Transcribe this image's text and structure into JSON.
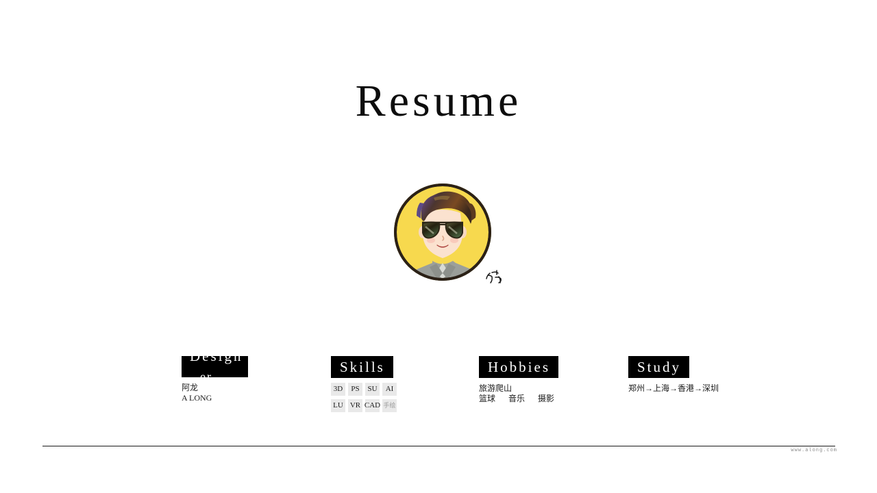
{
  "slide": {
    "title": "Resume",
    "background_color": "#ffffff"
  },
  "avatar": {
    "alt": "cartoon portrait avatar",
    "circle_color": "#f7d94e",
    "ring_color": "#2b2117",
    "hair_color": "#6b4326",
    "hair_highlight": "#7a5ba6",
    "skin_color": "#fbe2cf",
    "shirt_color": "#9b9f9a",
    "glasses_color": "#23200f",
    "signature": "阿龙"
  },
  "sections": {
    "design": {
      "header": "Design",
      "header_clipped_second_line": "er",
      "name_cn": "阿龙",
      "name_en": "A  LONG"
    },
    "skills": {
      "header": "Skills",
      "chips": [
        {
          "label": "3D",
          "muted": false
        },
        {
          "label": "PS",
          "muted": false
        },
        {
          "label": "SU",
          "muted": false
        },
        {
          "label": "AI",
          "muted": false
        },
        {
          "label": "LU",
          "muted": false
        },
        {
          "label": "VR",
          "muted": false
        },
        {
          "label": "CAD",
          "muted": false
        },
        {
          "label": "手绘",
          "muted": true
        }
      ]
    },
    "hobbies": {
      "header": "Hobbies",
      "line1": "旅游爬山",
      "line2": [
        "篮球",
        "音乐",
        "摄影"
      ]
    },
    "study": {
      "header": "Study",
      "path": "郑州→上海→香港→深圳"
    }
  },
  "footer": {
    "url": "www.along.com"
  }
}
